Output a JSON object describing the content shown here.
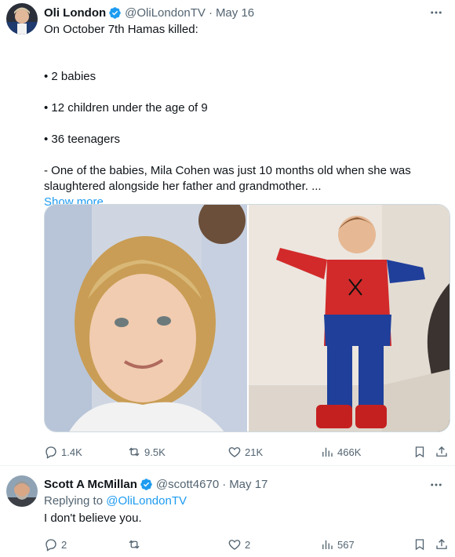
{
  "tweets": [
    {
      "author_name": "Oli London",
      "author_handle": "@OliLondonTV",
      "separator": "·",
      "time": "May 16",
      "text_lines": [
        "On October 7th Hamas killed:",
        "• 2 babies",
        "• 12 children under the age of 9",
        "•  36 teenagers",
        "- One of the babies, Mila Cohen was just 10 months old when she was",
        "slaughtered alongside her father and grandmother. ..."
      ],
      "show_more": "Show more",
      "verified": true,
      "stats": {
        "replies": "1.4K",
        "reposts": "9.5K",
        "likes": "21K",
        "views": "466K"
      }
    },
    {
      "author_name": "Scott A McMillan",
      "author_handle": "@scott4670",
      "separator": "·",
      "time": "May 17",
      "replying_prefix": "Replying to",
      "replying_handle": "@OliLondonTV",
      "text": "I don't believe you.",
      "verified": true,
      "stats": {
        "replies": "2",
        "reposts": "",
        "likes": "2",
        "views": "567"
      }
    }
  ],
  "colors": {
    "accent": "#1d9bf0",
    "text": "#0f1419",
    "muted": "#536471",
    "border": "#eff3f4"
  },
  "icons": [
    "more-icon",
    "verified-badge-icon",
    "reply-icon",
    "repost-icon",
    "like-icon",
    "views-icon",
    "bookmark-icon",
    "share-icon"
  ]
}
